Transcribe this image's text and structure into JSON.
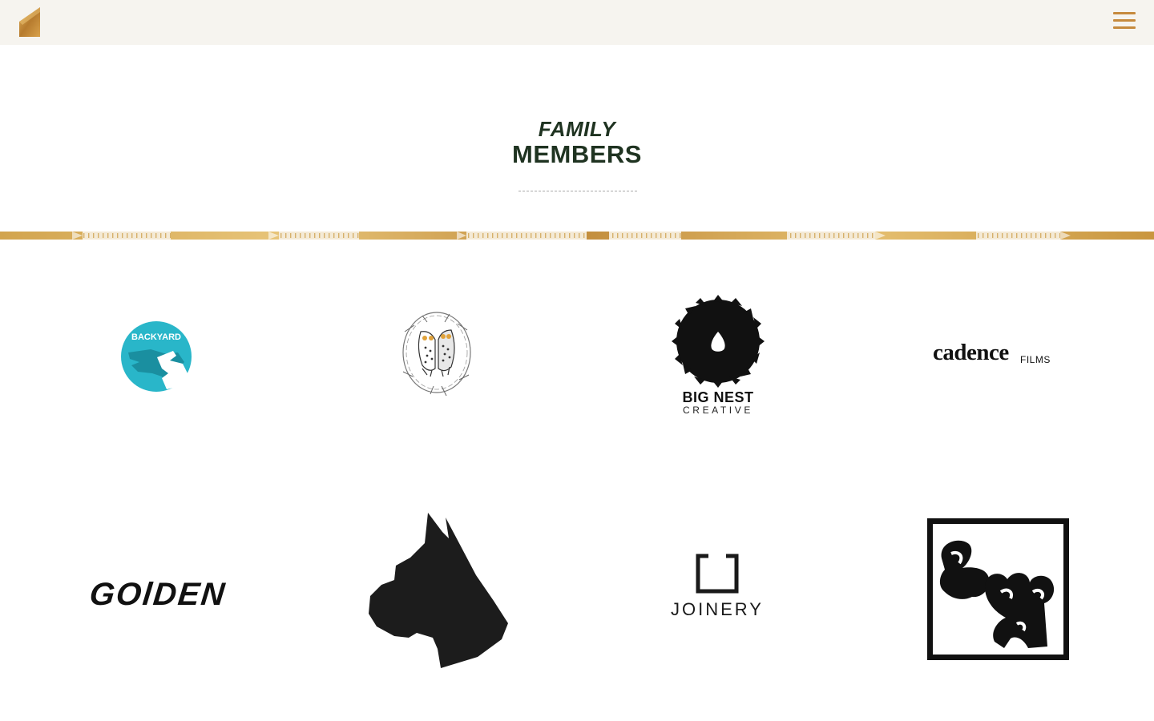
{
  "header": {
    "logo_icon": "gold-wedge-logo",
    "menu_icon": "hamburger-icon",
    "accent_color": "#c68a3e",
    "background_color": "#f6f4ef"
  },
  "section": {
    "kicker": "FAMILY",
    "title": "MEMBERS",
    "title_color": "#1f3321"
  },
  "logos": {
    "backyard": {
      "text": "BACKYARD",
      "color": "#29b6c9"
    },
    "owls": {
      "icon": "owls-nest-icon"
    },
    "bignest": {
      "line1": "BIG NEST",
      "line2": "CREATIVE"
    },
    "cadence": {
      "word": "cadence",
      "suffix": "FILMS"
    },
    "golden": {
      "word": "GOlDEN"
    },
    "boxer": {
      "icon": "boxer-dog-head-icon"
    },
    "joinery": {
      "word": "JOINERY"
    },
    "bombed": {
      "icon": "graffiti-box-icon"
    }
  }
}
